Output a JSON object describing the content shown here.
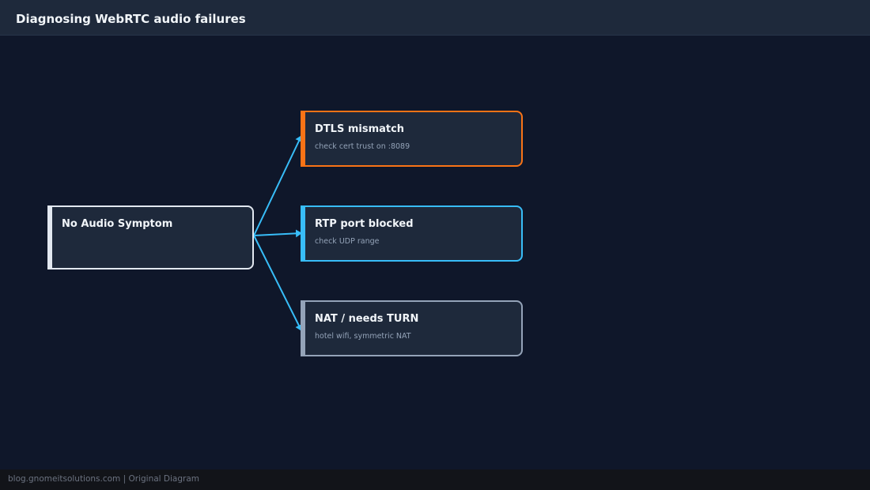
{
  "header": {
    "title": "Diagnosing WebRTC audio failures"
  },
  "diagram": {
    "root": {
      "label": "No Audio Symptom"
    },
    "branches": [
      {
        "label": "DTLS mismatch",
        "detail": "check cert trust on :8089",
        "accent": "#f97316"
      },
      {
        "label": "RTP port blocked",
        "detail": "check UDP range",
        "accent": "#38bdf8"
      },
      {
        "label": "NAT / needs TURN",
        "detail": "hotel wifi, symmetric NAT",
        "accent": "#94a3b8"
      }
    ],
    "edge_color": "#38bdf8"
  },
  "footer": {
    "text": "blog.gnomeitsolutions.com | Original Diagram"
  }
}
